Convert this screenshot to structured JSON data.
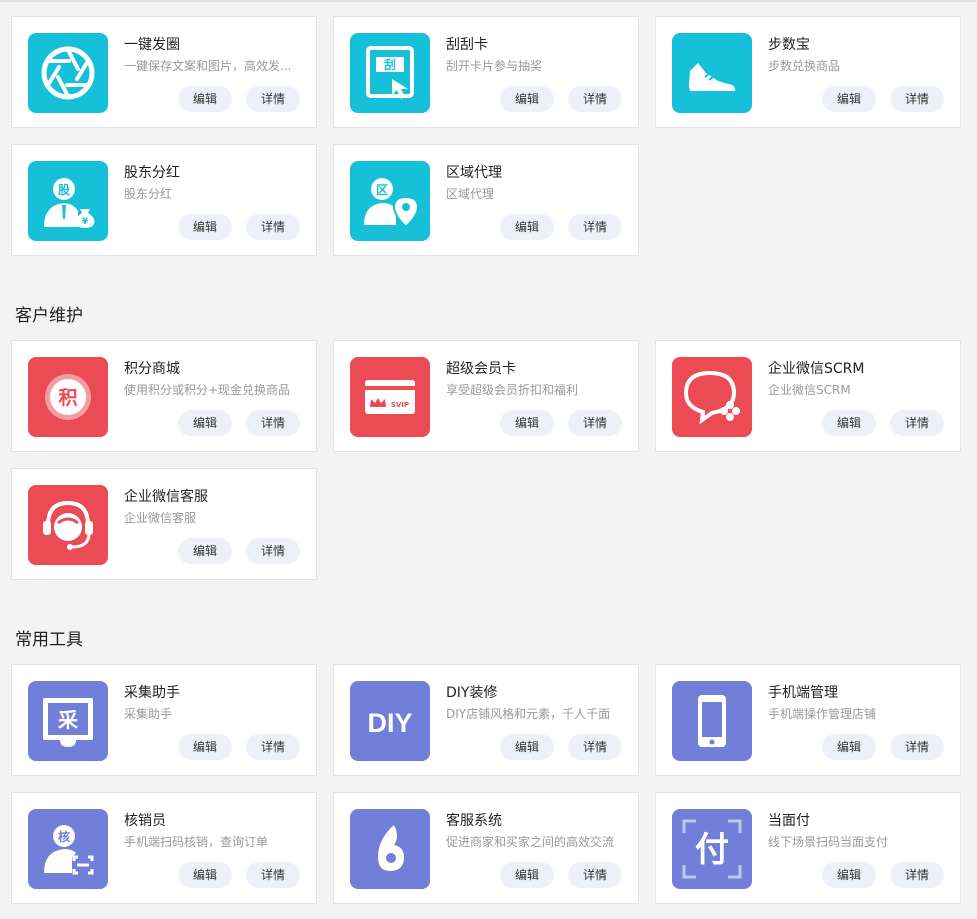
{
  "sections": [
    {
      "title": ""
    },
    {
      "title": "客户维护"
    },
    {
      "title": "常用工具"
    }
  ],
  "buttons": {
    "edit": "编辑",
    "detail": "详情"
  },
  "colors": {
    "cyan": "#16c0d9",
    "red": "#ea4b55",
    "purple": "#727fd9",
    "button_bg": "#eef0f9"
  },
  "cards": [
    {
      "name": "一键发圈",
      "desc": "一键保存文案和图片，高效发...",
      "icon": "camera-shutter-icon"
    },
    {
      "name": "刮刮卡",
      "desc": "刮开卡片参与抽奖",
      "icon": "scratch-card-icon",
      "icon_text": "刮"
    },
    {
      "name": "步数宝",
      "desc": "步数兑换商品",
      "icon": "sneaker-icon"
    },
    {
      "name": "股东分红",
      "desc": "股东分红",
      "icon": "shareholder-icon",
      "icon_text": "股",
      "icon_text2": "¥"
    },
    {
      "name": "区域代理",
      "desc": "区域代理",
      "icon": "region-agent-icon",
      "icon_text": "区"
    },
    {
      "name": "积分商城",
      "desc": "使用积分或积分+现金兑换商品",
      "icon": "points-mall-icon",
      "icon_text": "积"
    },
    {
      "name": "超级会员卡",
      "desc": "享受超级会员折扣和福利",
      "icon": "svip-card-icon",
      "icon_text": "SVIP"
    },
    {
      "name": "企业微信SCRM",
      "desc": "企业微信SCRM",
      "icon": "wecom-scrm-icon"
    },
    {
      "name": "企业微信客服",
      "desc": "企业微信客服",
      "icon": "customer-service-headset-icon"
    },
    {
      "name": "采集助手",
      "desc": "采集助手",
      "icon": "collect-assistant-icon",
      "icon_text": "采"
    },
    {
      "name": "DIY装修",
      "desc": "DIY店铺风格和元素，千人千面",
      "icon": "diy-icon",
      "icon_text": "DIY"
    },
    {
      "name": "手机端管理",
      "desc": "手机端操作管理店铺",
      "icon": "mobile-phone-icon"
    },
    {
      "name": "核销员",
      "desc": "手机端扫码核销，查询订单",
      "icon": "verifier-icon",
      "icon_text": "核"
    },
    {
      "name": "客服系统",
      "desc": "促进商家和买家之间的高效交流",
      "icon": "customer-service-system-icon"
    },
    {
      "name": "当面付",
      "desc": "线下场景扫码当面支付",
      "icon": "face-to-face-pay-icon",
      "icon_text": "付"
    }
  ]
}
